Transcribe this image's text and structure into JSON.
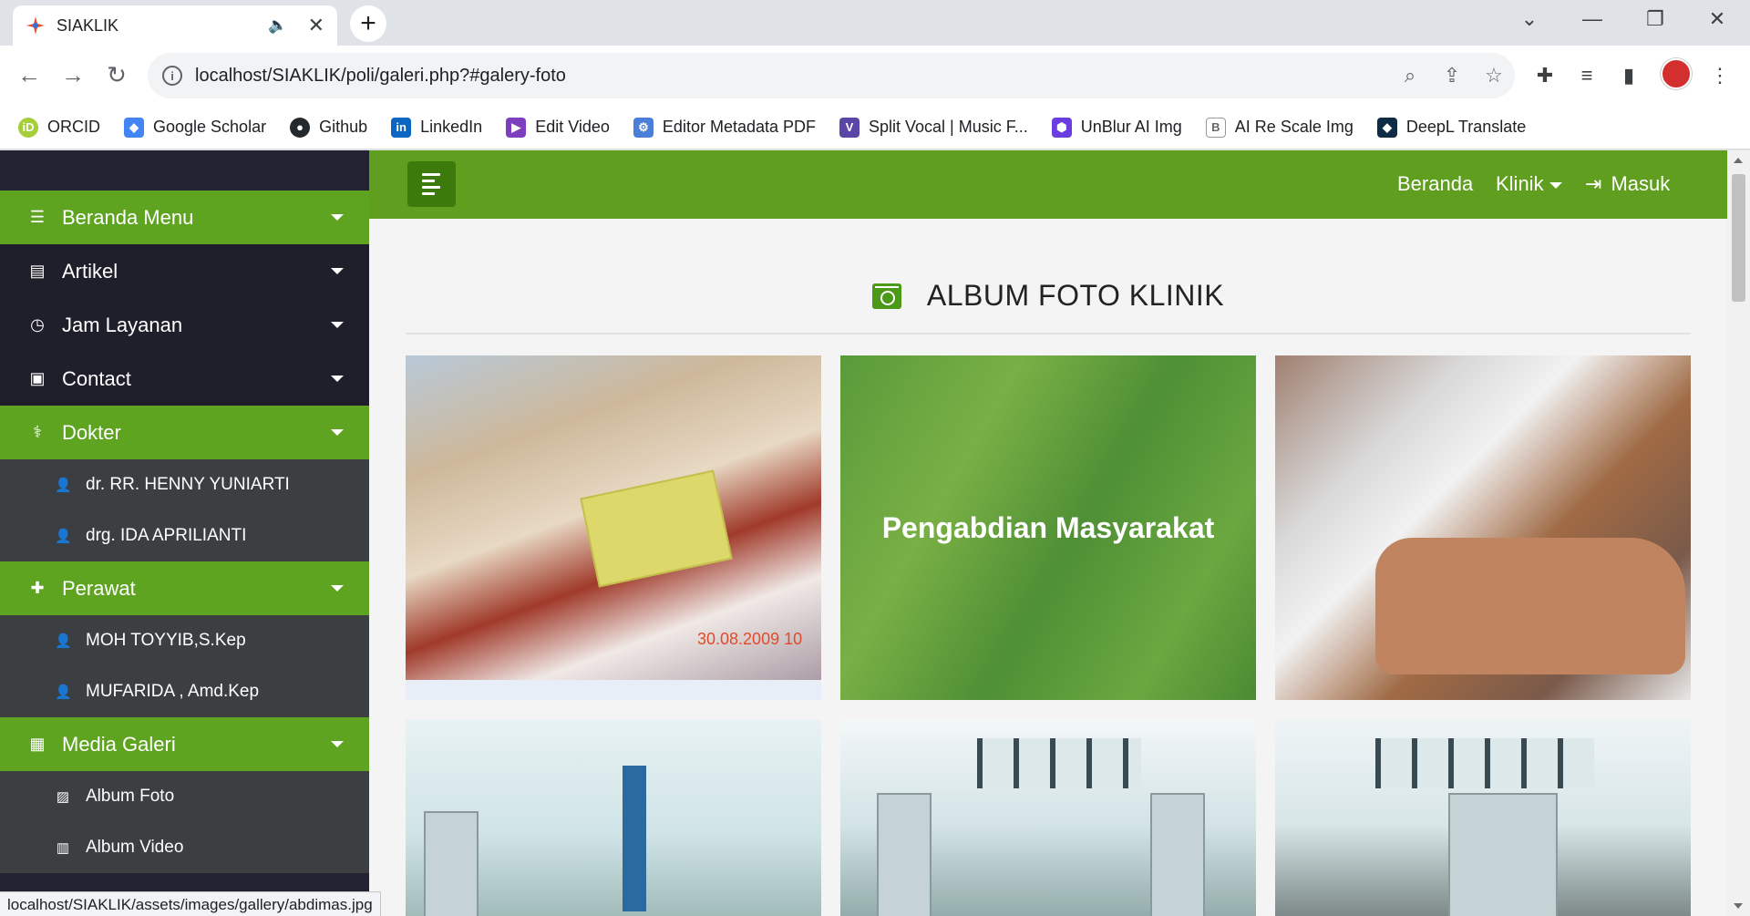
{
  "browser": {
    "tab_title": "SIAKLIK",
    "url": "localhost/SIAKLIK/poli/galeri.php?#galery-foto",
    "bookmarks": [
      {
        "label": "ORCID",
        "icon": "orcid-icon",
        "color": "#a6ce39",
        "glyph": "iD"
      },
      {
        "label": "Google Scholar",
        "icon": "google-scholar-icon",
        "color": "#4285f4",
        "glyph": "◆"
      },
      {
        "label": "Github",
        "icon": "github-icon",
        "color": "#24292e",
        "glyph": "●"
      },
      {
        "label": "LinkedIn",
        "icon": "linkedin-icon",
        "color": "#0a66c2",
        "glyph": "in"
      },
      {
        "label": "Edit Video",
        "icon": "edit-video-icon",
        "color": "#7e3fbf",
        "glyph": "▶"
      },
      {
        "label": "Editor Metadata PDF",
        "icon": "pdf-metadata-icon",
        "color": "#4a7fd9",
        "glyph": "⚙"
      },
      {
        "label": "Split Vocal | Music F...",
        "icon": "split-vocal-icon",
        "color": "#5a46a6",
        "glyph": "V"
      },
      {
        "label": "UnBlur AI Img",
        "icon": "unblur-icon",
        "color": "#6a3de0",
        "glyph": "⬢"
      },
      {
        "label": "AI Re Scale Img",
        "icon": "rescale-icon",
        "color": "#666666",
        "glyph": "B"
      },
      {
        "label": "DeepL Translate",
        "icon": "deepl-icon",
        "color": "#0f2b46",
        "glyph": "◆"
      }
    ],
    "status_url": "localhost/SIAKLIK/assets/images/gallery/abdimas.jpg"
  },
  "sidebar": {
    "items": [
      {
        "label": "Beranda Menu",
        "icon": "list-icon",
        "glyph": "☰",
        "style": "green"
      },
      {
        "label": "Artikel",
        "icon": "newspaper-icon",
        "glyph": "▤",
        "style": "dark"
      },
      {
        "label": "Jam Layanan",
        "icon": "clock-icon",
        "glyph": "◷",
        "style": "dark"
      },
      {
        "label": "Contact",
        "icon": "contact-icon",
        "glyph": "▣",
        "style": "dark"
      }
    ],
    "dokter": {
      "label": "Dokter",
      "icon": "stethoscope-icon",
      "glyph": "⚕"
    },
    "dokter_items": [
      "dr. RR. HENNY YUNIARTI",
      "drg. IDA APRILIANTI"
    ],
    "perawat": {
      "label": "Perawat",
      "icon": "medkit-icon",
      "glyph": "✚"
    },
    "perawat_items": [
      "MOH TOYYIB,S.Kep",
      "MUFARIDA , Amd.Kep"
    ],
    "galeri": {
      "label": "Media Galeri",
      "icon": "photo-video-icon",
      "glyph": "▦"
    },
    "galeri_items": [
      {
        "label": "Album Foto",
        "icon": "image-icon",
        "glyph": "▨"
      },
      {
        "label": "Album Video",
        "icon": "film-icon",
        "glyph": "▥"
      }
    ],
    "accent": "#5ea421"
  },
  "topnav": {
    "beranda": "Beranda",
    "klinik": "Klinik",
    "masuk": "Masuk"
  },
  "album": {
    "title": "ALBUM FOTO KLINIK",
    "photo_overlay_title": "Pengabdian Masyarakat",
    "photo_date": "30.08.2009 10"
  }
}
